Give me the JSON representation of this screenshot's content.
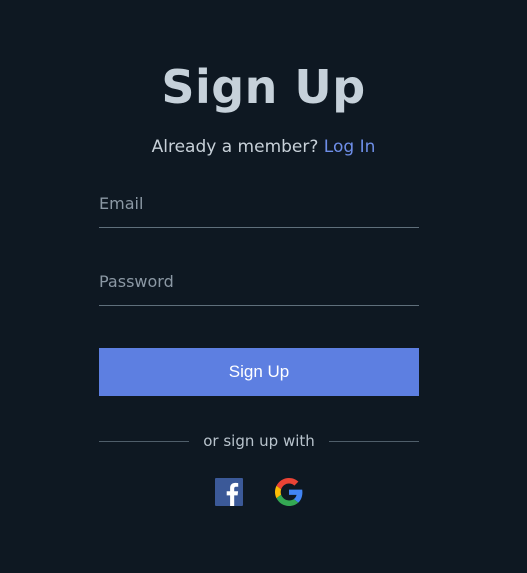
{
  "form": {
    "title": "Sign Up",
    "member_prompt": "Already a member?",
    "login_link": "Log In",
    "email_placeholder": "Email",
    "password_placeholder": "Password",
    "submit_label": "Sign Up",
    "divider_text": "or sign up with"
  },
  "social": [
    {
      "icon": "facebook-icon",
      "color": "#3b5998"
    },
    {
      "icon": "google-icon",
      "colors": [
        "#4285F4",
        "#EA4335",
        "#FBBC05",
        "#34A853"
      ]
    }
  ],
  "colors": {
    "background": "#0e1822",
    "accent": "#5d7fe1",
    "link": "#6e8ee8",
    "title": "#c6d1da"
  }
}
